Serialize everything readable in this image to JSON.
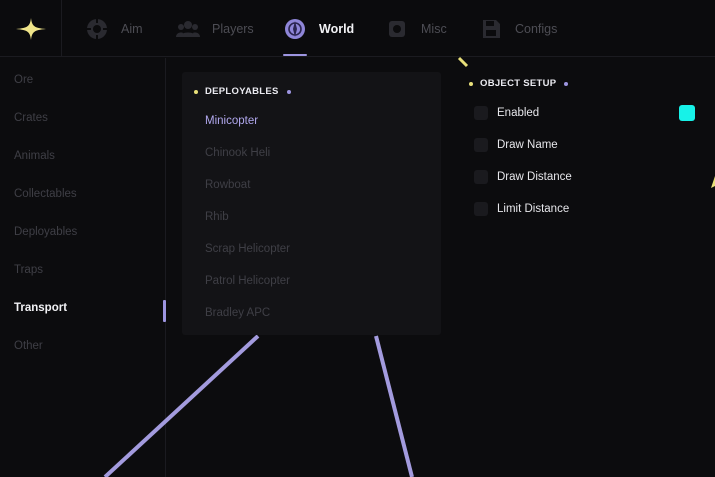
{
  "tabs": [
    {
      "label": "Aim",
      "icon": "crosshair-icon"
    },
    {
      "label": "Players",
      "icon": "players-icon"
    },
    {
      "label": "World",
      "icon": "globe-icon",
      "active": true
    },
    {
      "label": "Misc",
      "icon": "gear-icon"
    },
    {
      "label": "Configs",
      "icon": "save-icon"
    }
  ],
  "sidebar": {
    "items": [
      {
        "label": "Ore"
      },
      {
        "label": "Crates"
      },
      {
        "label": "Animals"
      },
      {
        "label": "Collectables"
      },
      {
        "label": "Deployables"
      },
      {
        "label": "Traps"
      },
      {
        "label": "Transport",
        "active": true
      },
      {
        "label": "Other"
      }
    ]
  },
  "deployables": {
    "title": "DEPLOYABLES",
    "items": [
      {
        "label": "Minicopter",
        "active": true
      },
      {
        "label": "Chinook Heli"
      },
      {
        "label": "Rowboat"
      },
      {
        "label": "Rhib"
      },
      {
        "label": "Scrap Helicopter"
      },
      {
        "label": "Patrol Helicopter"
      },
      {
        "label": "Bradley APC"
      }
    ]
  },
  "object_setup": {
    "title": "OBJECT SETUP",
    "options": [
      {
        "label": "Enabled",
        "checked": false
      },
      {
        "label": "Draw Name",
        "checked": false
      },
      {
        "label": "Draw Distance",
        "checked": false
      },
      {
        "label": "Limit Distance",
        "checked": false
      }
    ],
    "color_swatch": "#17f2e8"
  },
  "colors": {
    "accent": "#9d95e0",
    "highlight": "#e9e07a",
    "background": "#0c0c0e",
    "panel": "#131316"
  }
}
